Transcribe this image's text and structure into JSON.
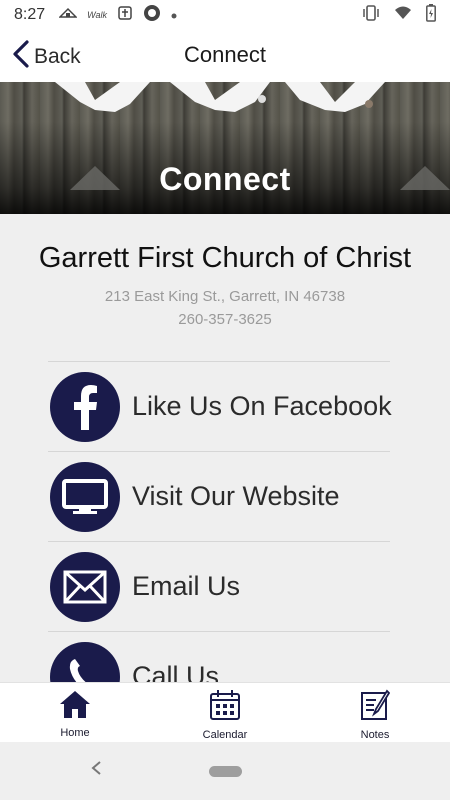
{
  "status_bar": {
    "time": "8:27",
    "left_icons": [
      "church-icon",
      "the-walk-icon",
      "bible-icon",
      "app-icon",
      "notification-dot-icon"
    ],
    "right_icons": [
      "vibrate-icon",
      "wifi-icon",
      "battery-charging-icon"
    ],
    "walk_text": "Walk"
  },
  "top_nav": {
    "back_label": "Back",
    "title": "Connect"
  },
  "banner": {
    "title": "Connect"
  },
  "church": {
    "name": "Garrett First Church of Christ",
    "address": "213 East King St., Garrett, IN 46738",
    "phone": "260-357-3625"
  },
  "links": [
    {
      "label": "Like Us On Facebook",
      "icon": "facebook-icon"
    },
    {
      "label": "Visit Our Website",
      "icon": "monitor-icon"
    },
    {
      "label": "Email Us",
      "icon": "envelope-icon"
    },
    {
      "label": "Call Us",
      "icon": "phone-icon"
    }
  ],
  "tabs": [
    {
      "label": "Home",
      "icon": "home-icon"
    },
    {
      "label": "Calendar",
      "icon": "calendar-icon"
    },
    {
      "label": "Notes",
      "icon": "notes-icon"
    }
  ],
  "colors": {
    "accent": "#1a1b4b",
    "background": "#efefef"
  }
}
